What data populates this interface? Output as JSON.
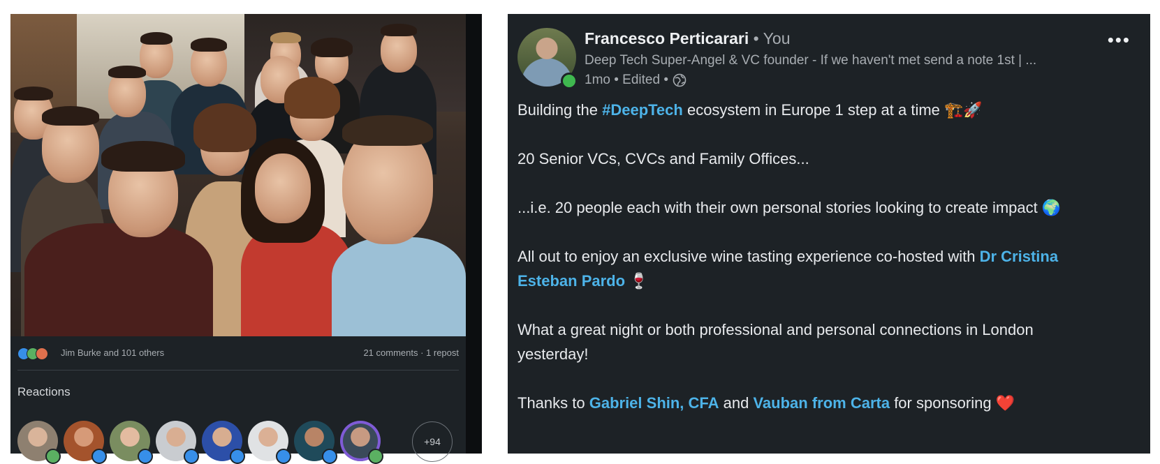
{
  "reactions_bar": {
    "reactors_text": "Jim Burke and 101 others",
    "comments_text": "21 comments · 1 repost"
  },
  "reactions_section": {
    "title": "Reactions",
    "more_count": "+94"
  },
  "post": {
    "author_name": "Francesco Perticarari",
    "author_relation": " • You",
    "author_headline": "Deep Tech Super-Angel & VC founder - If we haven't met send a note 1st | ...",
    "meta": "1mo • Edited •",
    "line1_pre": "Building the ",
    "line1_hashtag": "#DeepTech",
    "line1_post": " ecosystem in Europe 1 step at a time 🏗️🚀",
    "line2": "20 Senior VCs, CVCs and Family Offices...",
    "line3": "...i.e. 20 people each with their own personal stories looking to create impact 🌍",
    "line4_pre": "All out to enjoy an exclusive wine tasting experience co-hosted with ",
    "line4_mention_a": "Dr Cristina",
    "line4_mention_b": "Esteban Pardo",
    "line4_post": " 🍷",
    "line5a": "What a great night or both professional and personal connections in London",
    "line5b": "yesterday!",
    "line6_pre": "Thanks to ",
    "line6_mention1": "Gabriel Shin, CFA",
    "line6_mid": " and ",
    "line6_mention2": "Vauban from Carta",
    "line6_post": " for sponsoring ❤️"
  },
  "colors": {
    "panel_bg": "#1d2226",
    "link": "#4db3e8",
    "online": "#3fb84f"
  }
}
